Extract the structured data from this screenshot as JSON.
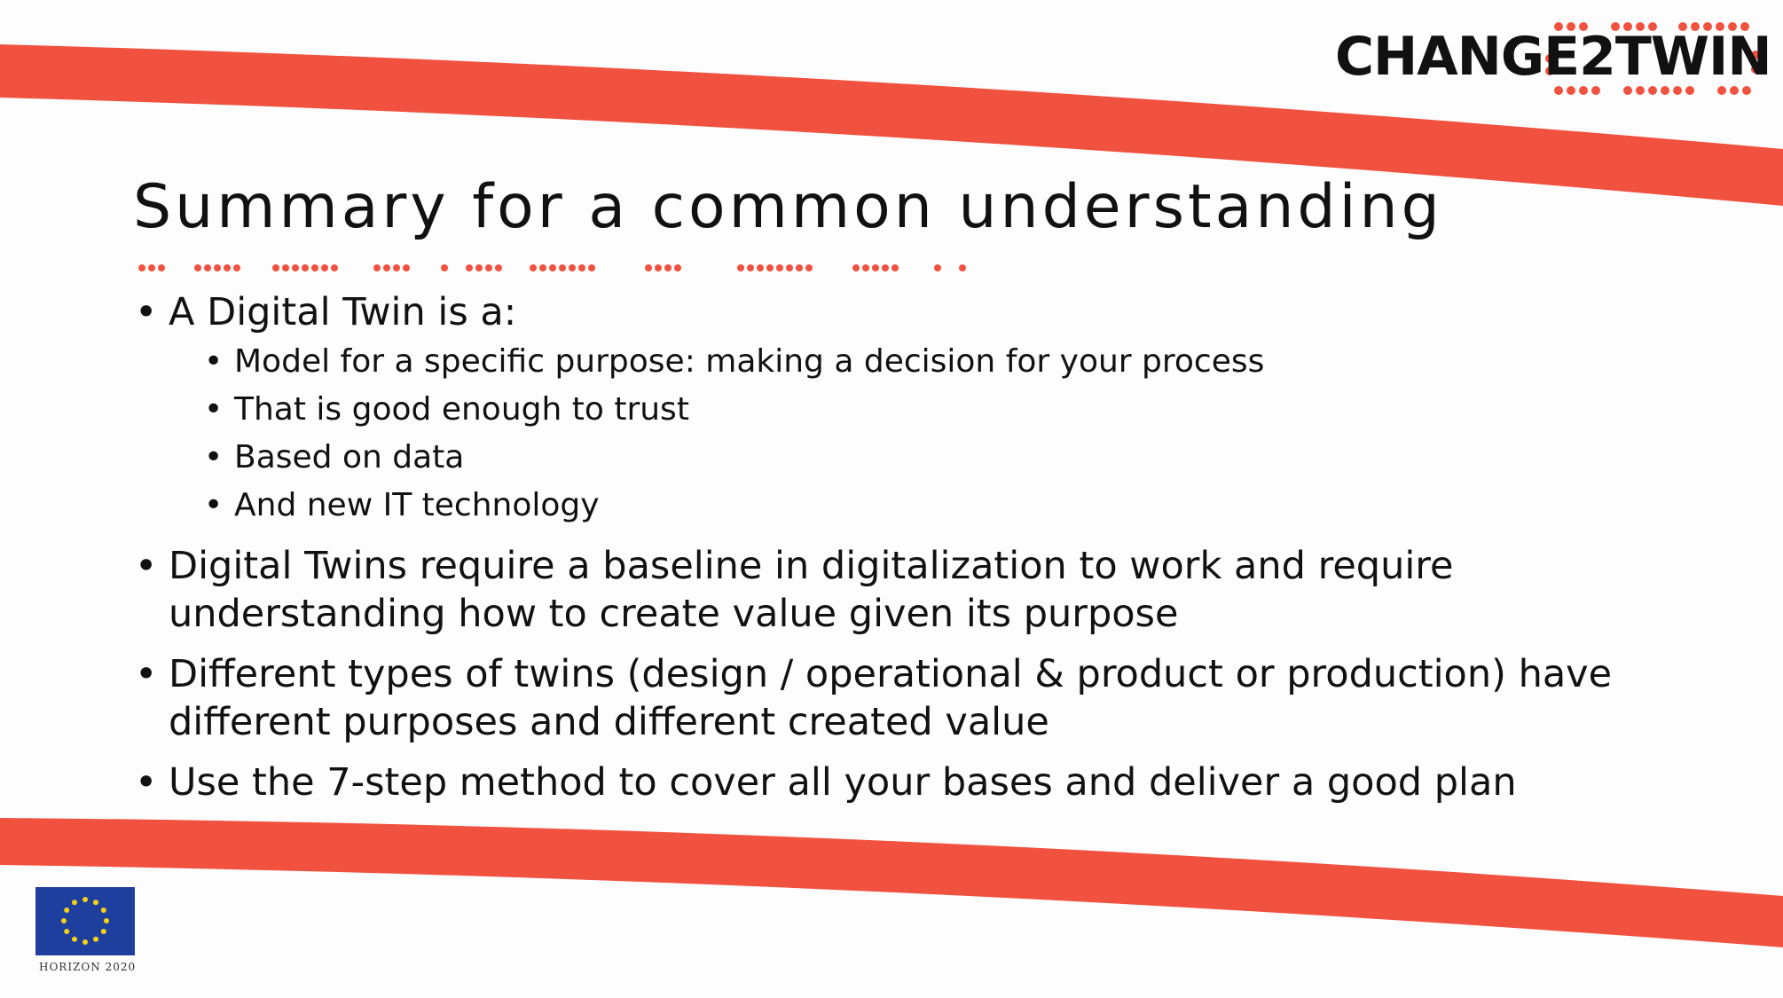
{
  "brand": {
    "logo_text": "CHANGE2TWIN",
    "accent_color": "#f1513f"
  },
  "slide": {
    "title": "Summary for a common understanding",
    "bullets": [
      {
        "text": "A Digital Twin is a:",
        "sub": [
          "Model for a specific purpose: making a decision for your process",
          "That is good enough to trust",
          "Based on data",
          "And new IT technology"
        ]
      },
      {
        "text": "Digital Twins require a baseline in digitalization to work and require understanding how to create value given its purpose"
      },
      {
        "text": "Different types of twins (design / operational & product or production) have different purposes and different created value"
      },
      {
        "text": "Use the 7-step method to cover all your bases and deliver a good plan"
      }
    ]
  },
  "footer": {
    "program": "HORIZON 2020",
    "flag_icon": "eu-flag-icon"
  }
}
